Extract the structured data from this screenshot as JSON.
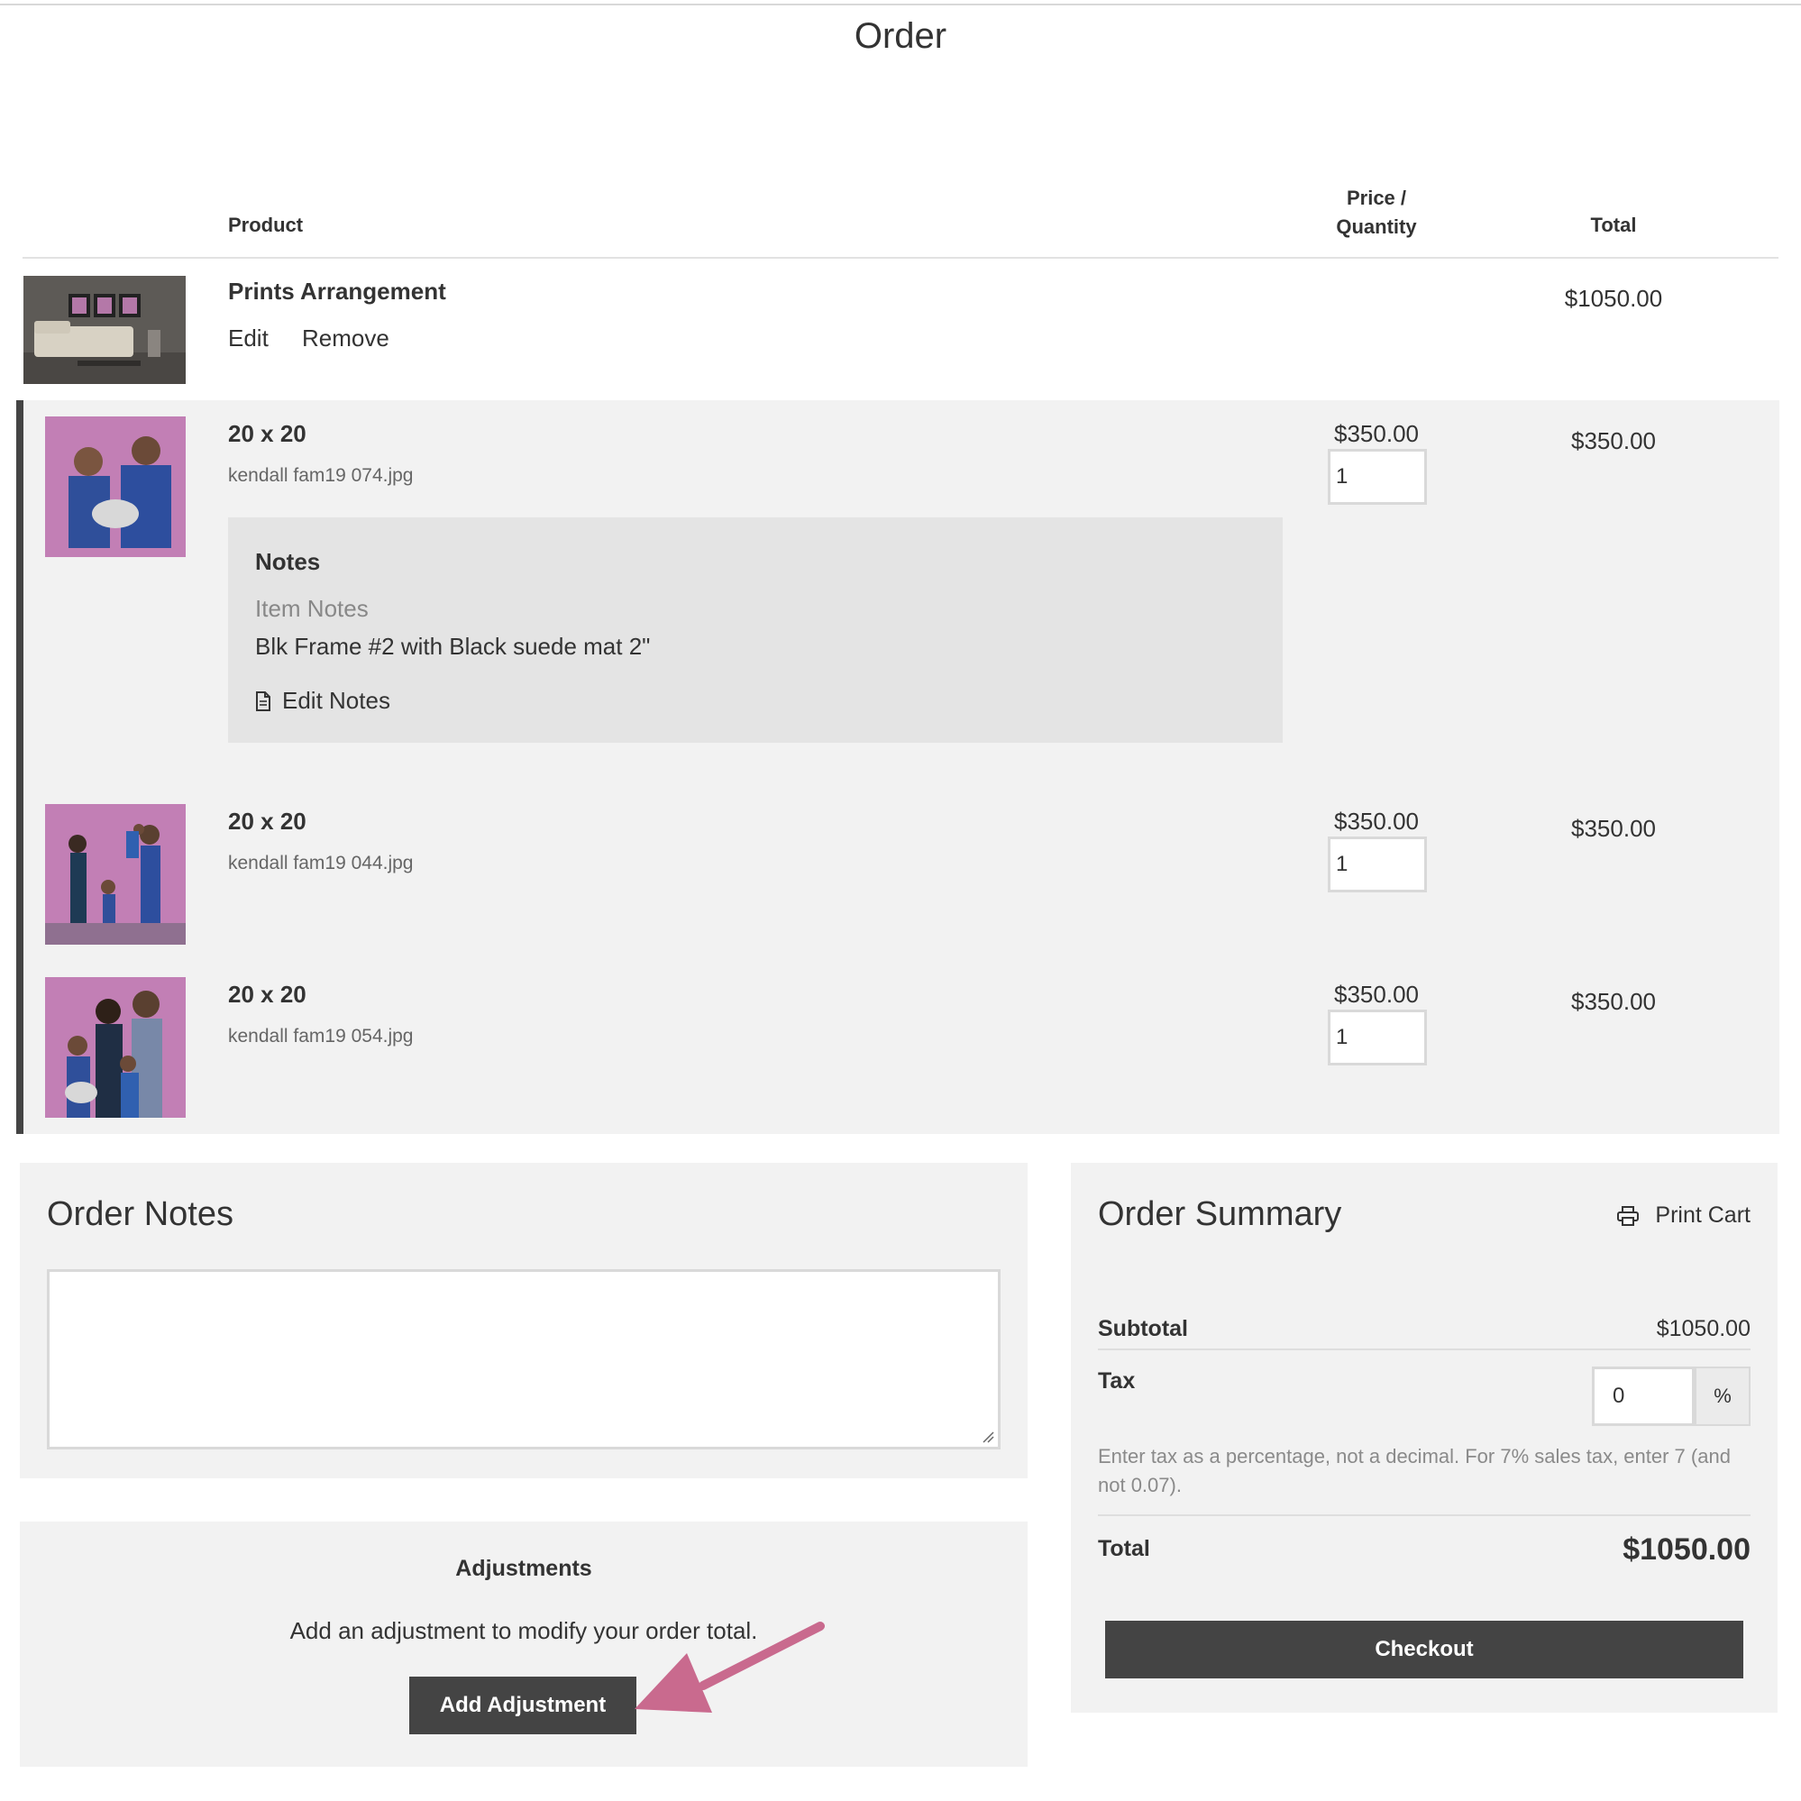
{
  "page": {
    "title": "Order"
  },
  "table": {
    "headers": {
      "product": "Product",
      "price_line1": "Price /",
      "price_line2": "Quantity",
      "total": "Total"
    }
  },
  "arrangement": {
    "title": "Prints Arrangement",
    "edit_label": "Edit",
    "remove_label": "Remove",
    "total": "$1050.00"
  },
  "items": [
    {
      "size": "20 x 20",
      "file": "kendall fam19 074.jpg",
      "price": "$350.00",
      "quantity": "1",
      "total": "$350.00"
    },
    {
      "size": "20 x 20",
      "file": "kendall fam19 044.jpg",
      "price": "$350.00",
      "quantity": "1",
      "total": "$350.00"
    },
    {
      "size": "20 x 20",
      "file": "kendall fam19 054.jpg",
      "price": "$350.00",
      "quantity": "1",
      "total": "$350.00"
    }
  ],
  "notes": {
    "title": "Notes",
    "label": "Item Notes",
    "text": "Blk Frame #2 with Black suede mat 2\"",
    "edit_label": "Edit Notes"
  },
  "order_notes": {
    "title": "Order Notes",
    "value": ""
  },
  "adjustments": {
    "title": "Adjustments",
    "description": "Add an adjustment to modify your order total.",
    "button_label": "Add Adjustment"
  },
  "summary": {
    "title": "Order Summary",
    "print_label": "Print Cart",
    "subtotal_label": "Subtotal",
    "subtotal_value": "$1050.00",
    "tax_label": "Tax",
    "tax_value": "0",
    "tax_unit": "%",
    "tax_help": "Enter tax as a percentage, not a decimal. For 7% sales tax, enter 7 (and not 0.07).",
    "total_label": "Total",
    "total_value": "$1050.00",
    "checkout_label": "Checkout"
  },
  "colors": {
    "button_dark": "#444444",
    "panel_bg": "#f2f2f2",
    "annotation_arrow": "#c96a8e",
    "photo_backdrop": "#c27fb5"
  },
  "icons": {
    "notes": "document-icon",
    "print": "printer-icon",
    "arrow": "annotation-arrow"
  }
}
